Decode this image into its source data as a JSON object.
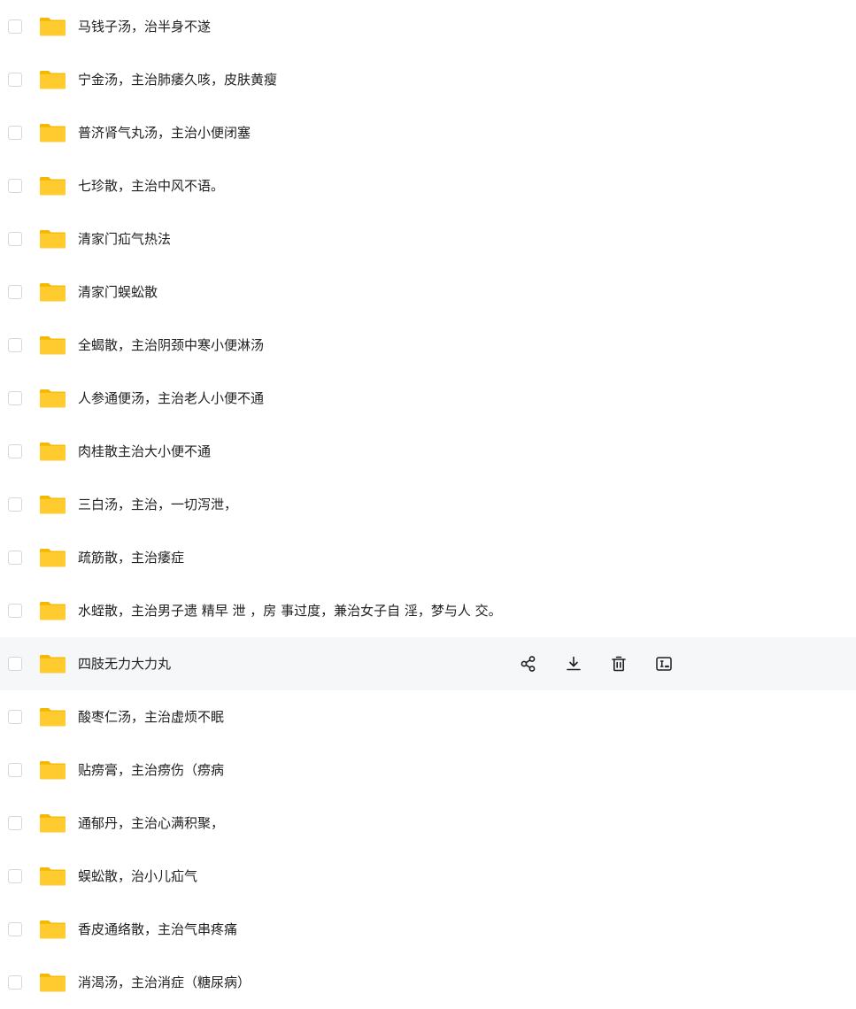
{
  "files": [
    {
      "name": "马钱子汤，治半身不遂"
    },
    {
      "name": "宁金汤，主治肺痿久咳，皮肤黄瘦"
    },
    {
      "name": "普济肾气丸汤，主治小便闭塞"
    },
    {
      "name": "七珍散，主治中风不语。"
    },
    {
      "name": "清家门疝气热法"
    },
    {
      "name": "清家门蜈蚣散"
    },
    {
      "name": "全蝎散，主治阴颈中寒小便淋汤"
    },
    {
      "name": "人参通便汤，主治老人小便不通"
    },
    {
      "name": "肉桂散主治大小便不通"
    },
    {
      "name": "三白汤，主治，一切泻泄，"
    },
    {
      "name": "疏筋散，主治痿症"
    },
    {
      "name": "水蛭散，主治男子遗 精早 泄 ，房 事过度，兼治女子自 淫，梦与人 交。"
    },
    {
      "name": "四肢无力大力丸",
      "hovered": true
    },
    {
      "name": "酸枣仁汤，主治虚烦不眠"
    },
    {
      "name": "贴痨膏，主治痨伤（痨病"
    },
    {
      "name": "通郁丹，主治心满积聚，"
    },
    {
      "name": "蜈蚣散，治小儿疝气"
    },
    {
      "name": "香皮通络散，主治气串疼痛"
    },
    {
      "name": "消渴汤，主治消症（糖尿病）"
    }
  ],
  "row_actions": [
    "share-icon",
    "download-icon",
    "delete-icon",
    "rename-icon"
  ],
  "colors": {
    "folder": "#ffcb2e",
    "folder_tab": "#f5b700",
    "hover_bg": "#f6f7f9",
    "icon": "#1f1f1f"
  }
}
